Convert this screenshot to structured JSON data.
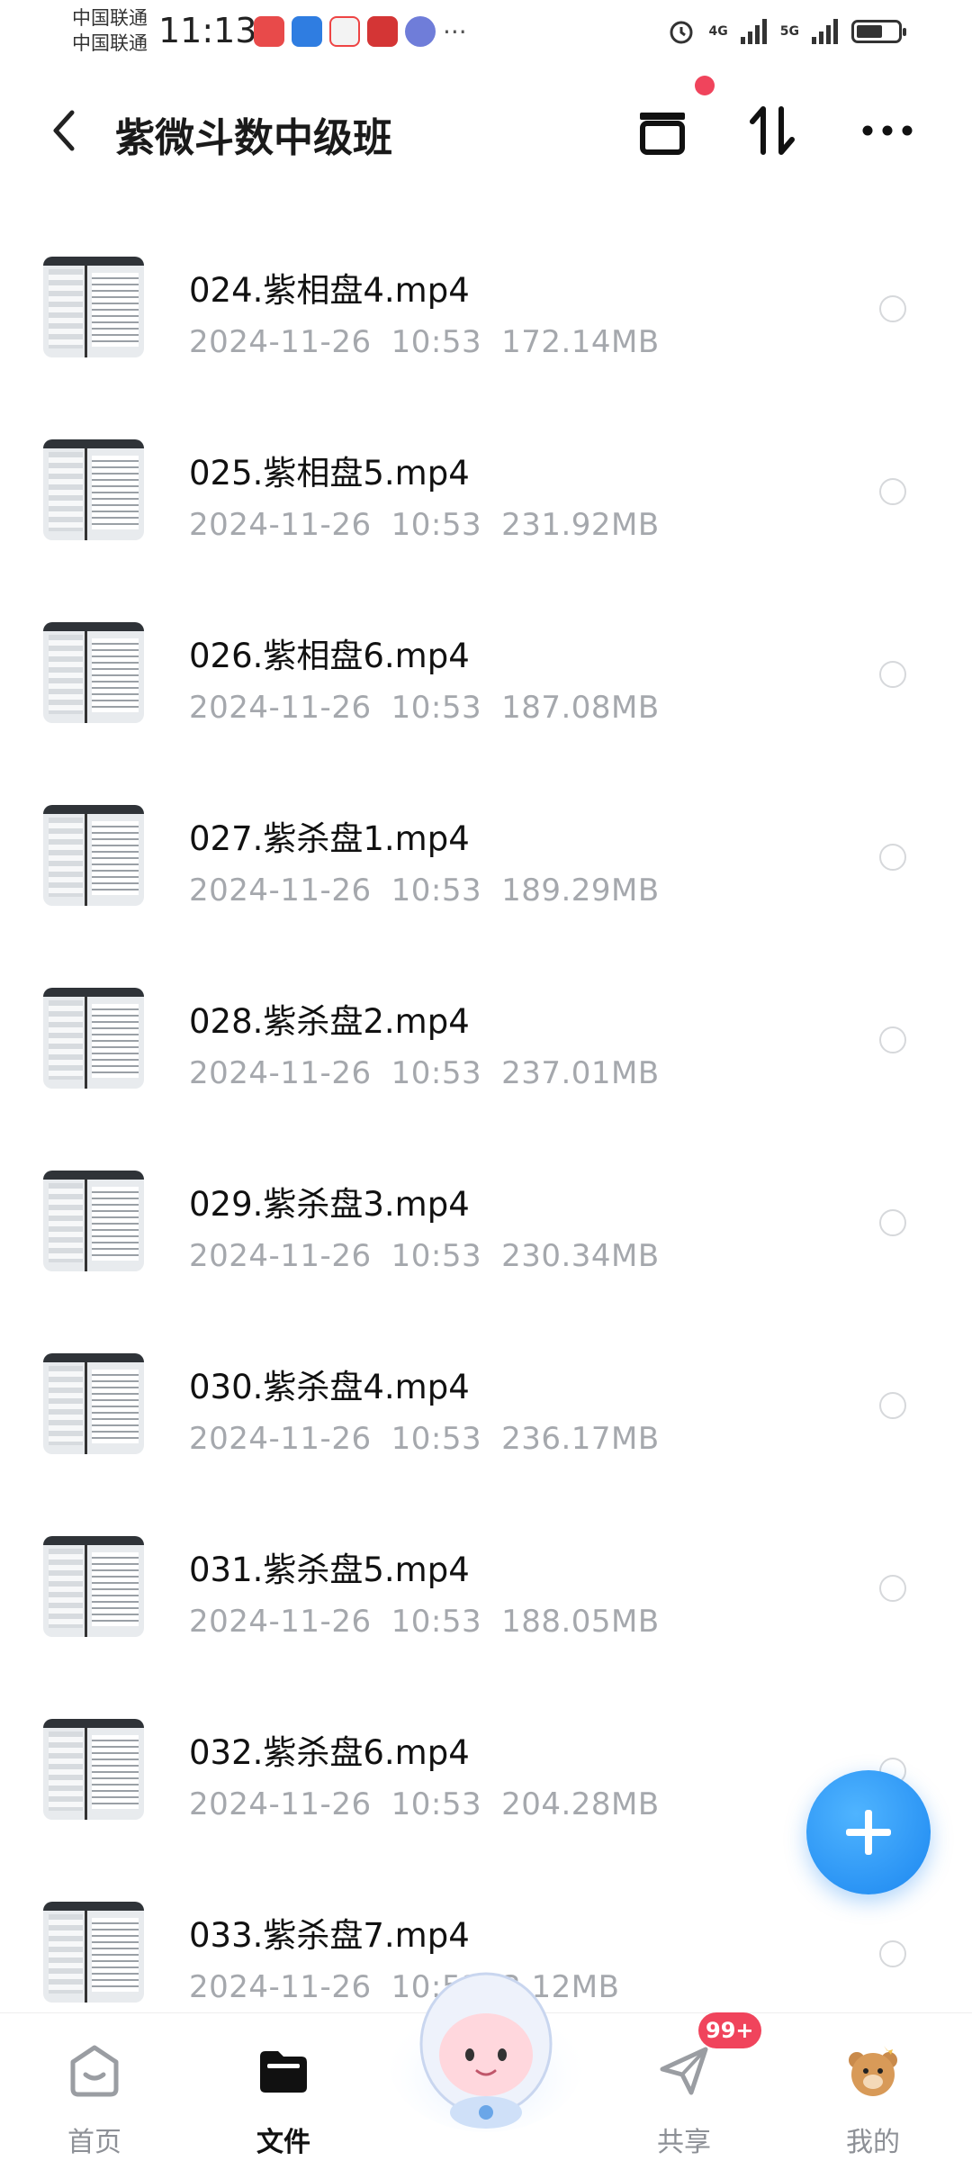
{
  "status_bar": {
    "carrier_1": "中国联通",
    "carrier_2": "中国联通",
    "time": "11:13",
    "signal_1": "4G",
    "signal_2": "5G"
  },
  "header": {
    "title": "紫微斗数中级班"
  },
  "files": [
    {
      "name": "024.紫相盘4.mp4",
      "date": "2024-11-26",
      "time": "10:53",
      "size": "172.14MB"
    },
    {
      "name": "025.紫相盘5.mp4",
      "date": "2024-11-26",
      "time": "10:53",
      "size": "231.92MB"
    },
    {
      "name": "026.紫相盘6.mp4",
      "date": "2024-11-26",
      "time": "10:53",
      "size": "187.08MB"
    },
    {
      "name": "027.紫杀盘1.mp4",
      "date": "2024-11-26",
      "time": "10:53",
      "size": "189.29MB"
    },
    {
      "name": "028.紫杀盘2.mp4",
      "date": "2024-11-26",
      "time": "10:53",
      "size": "237.01MB"
    },
    {
      "name": "029.紫杀盘3.mp4",
      "date": "2024-11-26",
      "time": "10:53",
      "size": "230.34MB"
    },
    {
      "name": "030.紫杀盘4.mp4",
      "date": "2024-11-26",
      "time": "10:53",
      "size": "236.17MB"
    },
    {
      "name": "031.紫杀盘5.mp4",
      "date": "2024-11-26",
      "time": "10:53",
      "size": "188.05MB"
    },
    {
      "name": "032.紫杀盘6.mp4",
      "date": "2024-11-26",
      "time": "10:53",
      "size": "204.28MB"
    },
    {
      "name": "033.紫杀盘7.mp4",
      "date": "2024-11-26",
      "time": "10:53",
      "size": "3.12MB"
    }
  ],
  "bottom_nav": {
    "items": [
      {
        "label": "首页",
        "icon": "home-icon"
      },
      {
        "label": "文件",
        "icon": "folder-icon"
      },
      {
        "label": "共享",
        "icon": "paper-plane-icon"
      },
      {
        "label": "我的",
        "icon": "bear-avatar-icon"
      }
    ],
    "share_badge": "99+",
    "active": "文件"
  },
  "colors": {
    "accent": "#1c87f0",
    "badge": "#f0445c",
    "meta_text": "#a5a8ad"
  }
}
